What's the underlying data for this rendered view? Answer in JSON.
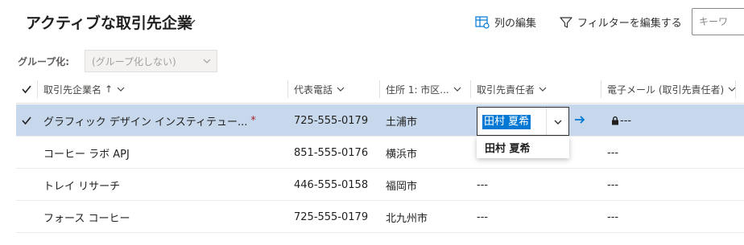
{
  "header": {
    "view_title": "アクティブな取引先企業",
    "edit_columns_label": "列の編集",
    "edit_filters_label": "フィルターを編集する",
    "search_placeholder": "キーワ"
  },
  "group": {
    "label": "グループ化:",
    "value": "(グループ化しない)"
  },
  "columns": [
    {
      "label": "取引先企業名",
      "sort": "↑"
    },
    {
      "label": "代表電話"
    },
    {
      "label": "住所 1: 市区..."
    },
    {
      "label": "取引先責任者"
    },
    {
      "label": "電子メール (取引先責任者)"
    }
  ],
  "rows": [
    {
      "name": "グラフィック デザイン インスティテュー...",
      "phone": "725-555-0179",
      "city": "土浦市",
      "owner": "田村 夏希",
      "email": "---",
      "selected": true
    },
    {
      "name": "コーヒー ラボ APJ",
      "phone": "851-555-0176",
      "city": "横浜市",
      "owner": "",
      "email": "---"
    },
    {
      "name": "トレイ リサーチ",
      "phone": "446-555-0158",
      "city": "福岡市",
      "owner": "---",
      "email": "---"
    },
    {
      "name": "フォース コーヒー",
      "phone": "725-555-0179",
      "city": "北九州市",
      "owner": "---",
      "email": "---"
    }
  ],
  "owner_editor": {
    "value": "田村 夏希",
    "dropdown_option": "田村 夏希"
  },
  "colors": {
    "selected_row": "#c7d8ec",
    "accent": "#0078d4",
    "required": "#a4262c"
  },
  "icons": [
    "chevron-down-icon",
    "edit-columns-icon",
    "filter-icon",
    "checkmark-icon",
    "sort-ascending-icon",
    "arrow-right-icon",
    "lock-icon"
  ]
}
